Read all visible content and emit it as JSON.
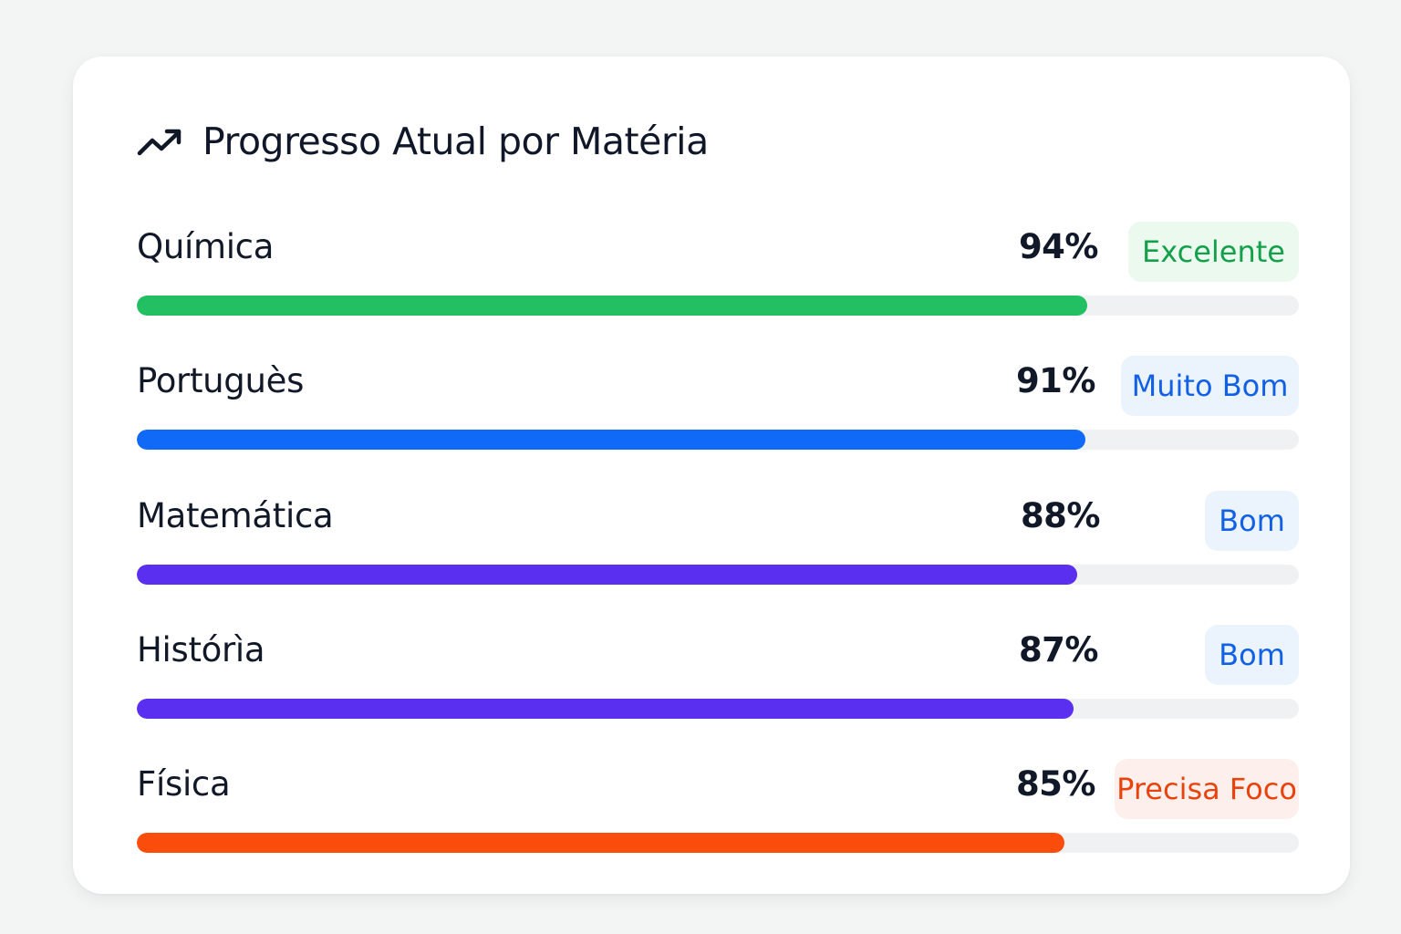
{
  "card": {
    "title": "Progresso Atual por Matéria",
    "title_icon": "trending-up-icon"
  },
  "subjects": [
    {
      "name": "Química",
      "percent_label": "94%",
      "progress": 0.818,
      "status": "Excelente",
      "bar_color": "#22c063",
      "badge_text_color": "#13a04b",
      "badge_bg": "#ebf9ef"
    },
    {
      "name": "Portuguès",
      "percent_label": "91%",
      "progress": 0.816,
      "status": "Muito Bom",
      "bar_color": "#106af7",
      "badge_text_color": "#1160e6",
      "badge_bg": "#ebf3fd"
    },
    {
      "name": "Matemática",
      "percent_label": "88%",
      "progress": 0.809,
      "status": "Bom",
      "bar_color": "#5a2fef",
      "badge_text_color": "#1160e6",
      "badge_bg": "#ebf3fd"
    },
    {
      "name": "Histórìa",
      "percent_label": "87%",
      "progress": 0.806,
      "status": "Bom",
      "bar_color": "#5a2fef",
      "badge_text_color": "#1160e6",
      "badge_bg": "#ebf3fd"
    },
    {
      "name": "Física",
      "percent_label": "85%",
      "progress": 0.798,
      "status": "Precisa Foco",
      "bar_color": "#fa4d0c",
      "badge_text_color": "#e8430d",
      "badge_bg": "#fdf0ec"
    }
  ]
}
